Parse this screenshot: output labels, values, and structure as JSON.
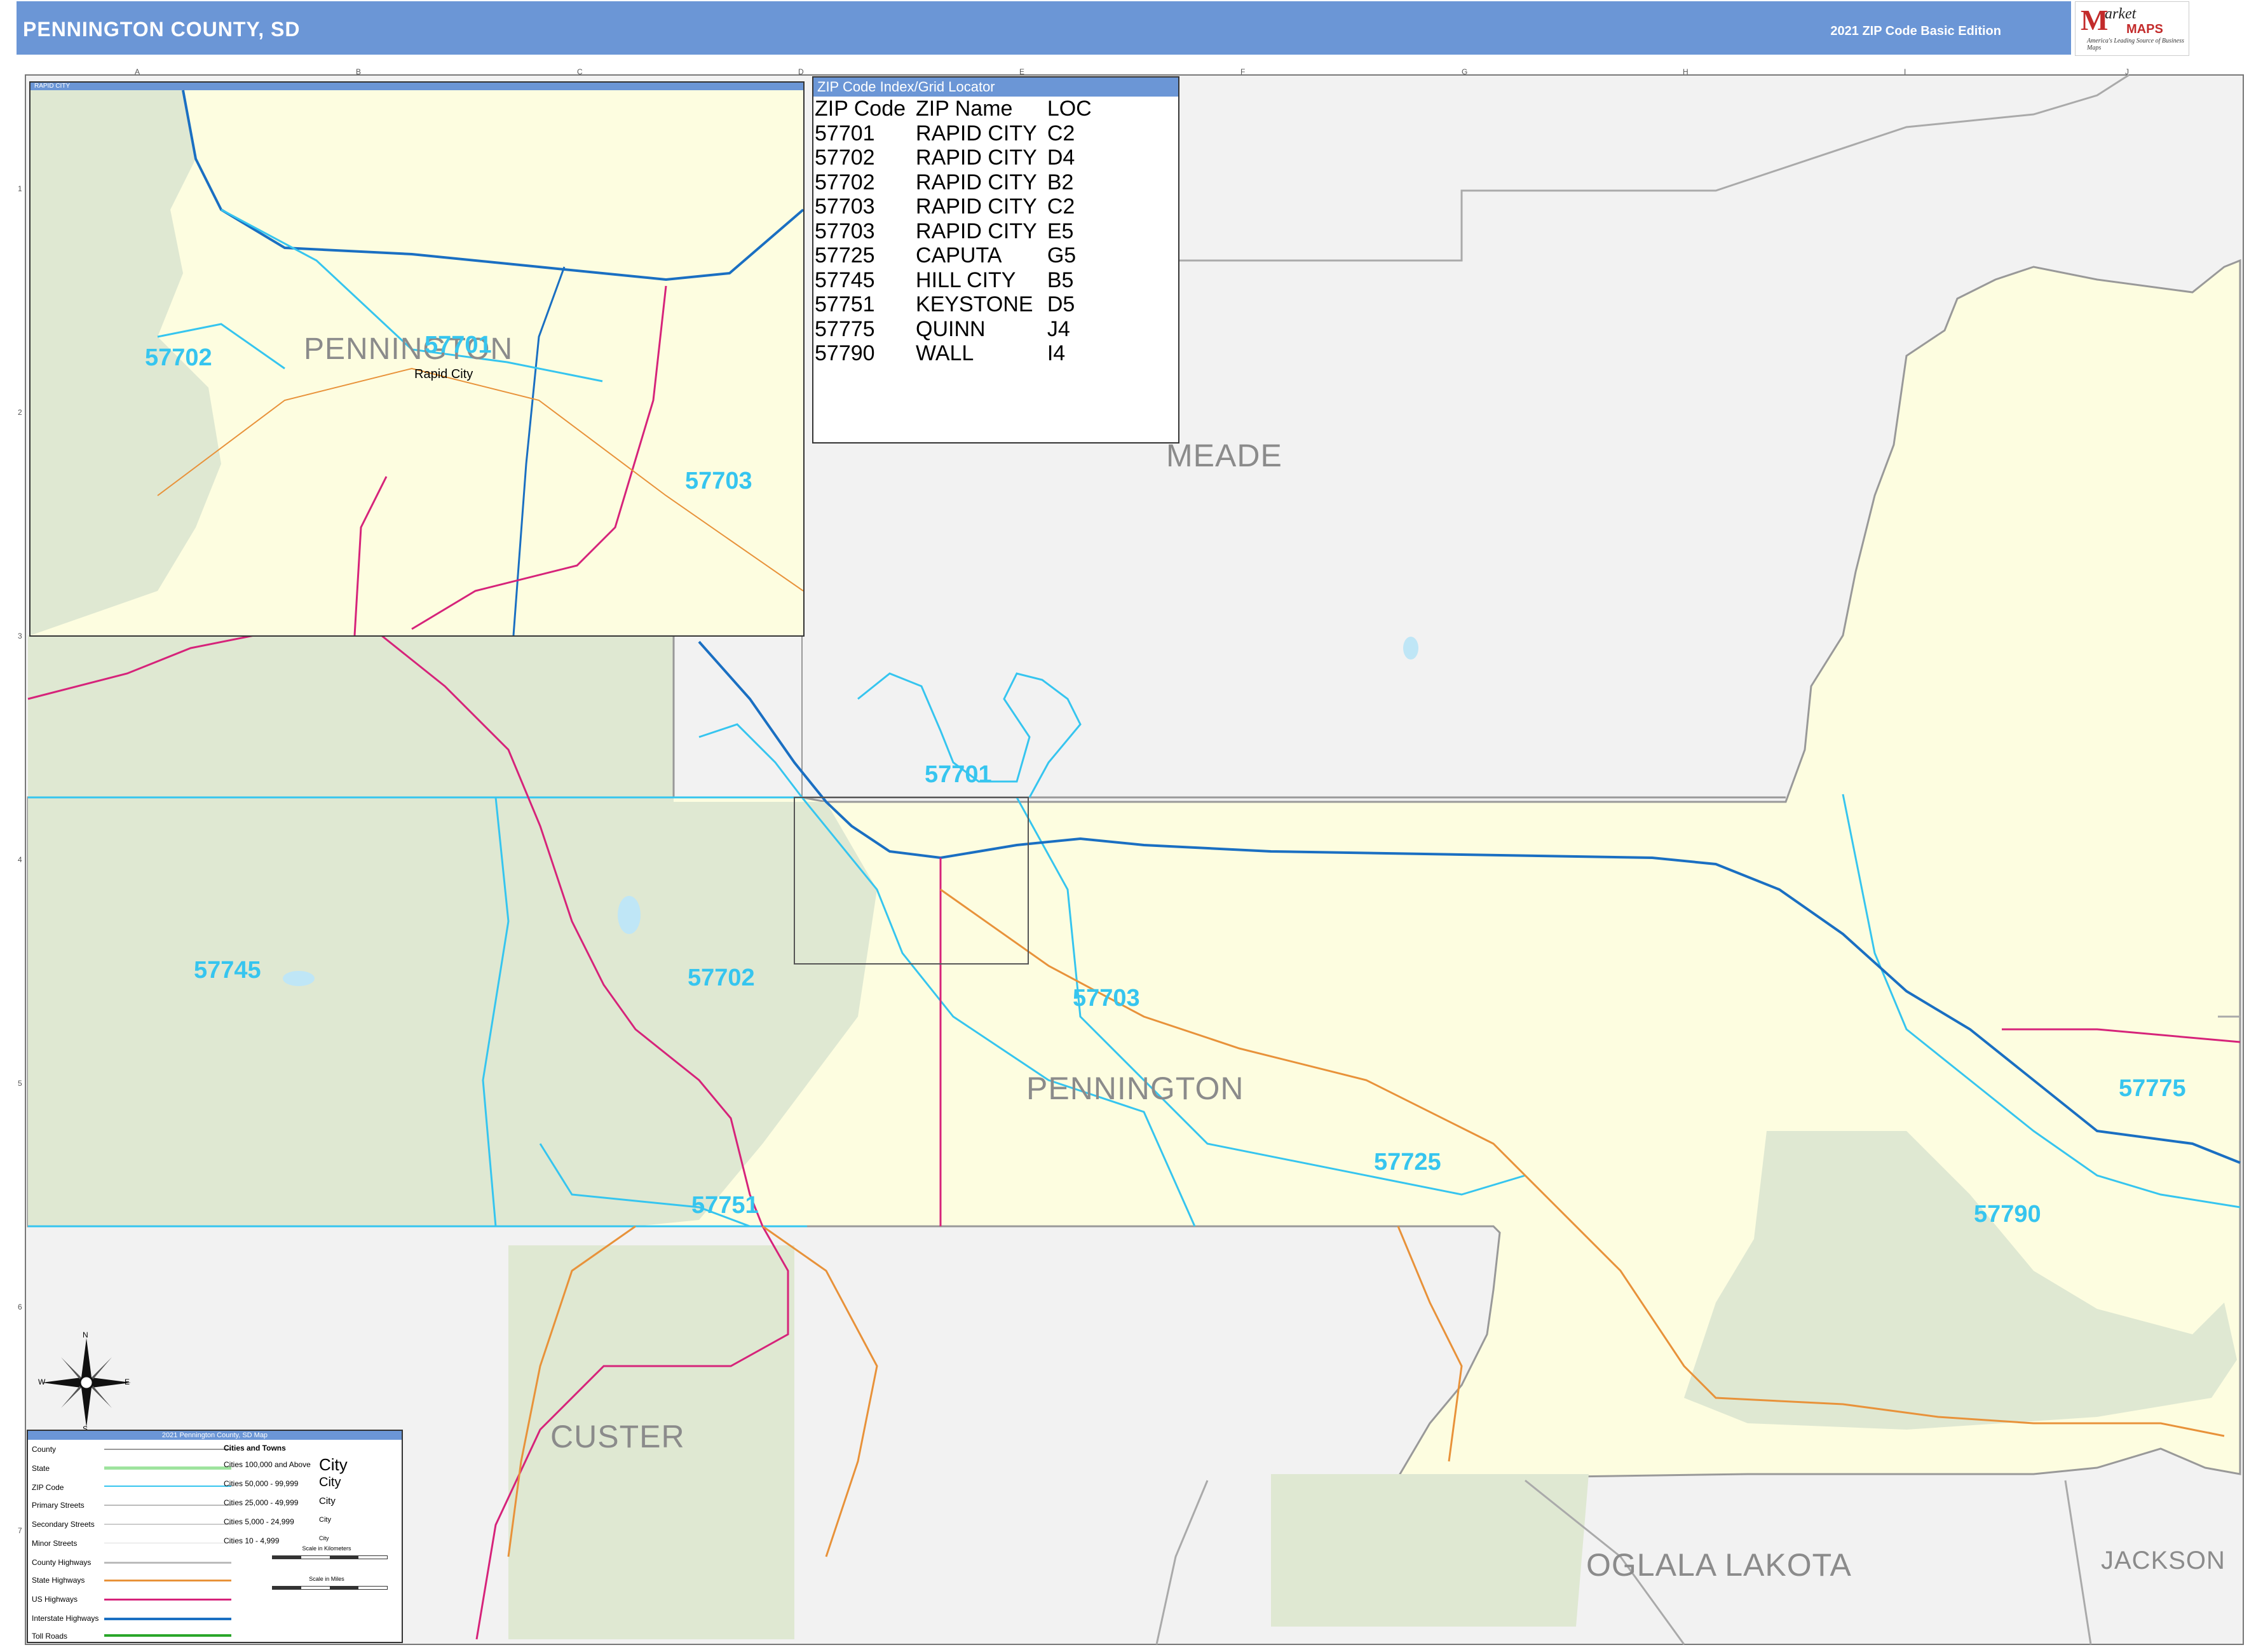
{
  "header": {
    "title": "PENNINGTON COUNTY, SD",
    "edition": "2021 ZIP Code Basic Edition"
  },
  "logo": {
    "m": "M",
    "market": "arket",
    "maps": "MAPS",
    "tagline": "America's Leading Source of Business Maps"
  },
  "grid": {
    "letters": [
      "A",
      "B",
      "C",
      "D",
      "E",
      "F",
      "G",
      "H",
      "I",
      "J"
    ],
    "numbers": [
      "1",
      "2",
      "3",
      "4",
      "5",
      "6",
      "7"
    ]
  },
  "inset": {
    "title": "RAPID CITY",
    "city_label": "Rapid City",
    "county_label": "PENNINGTON",
    "zips": [
      "57702",
      "57701",
      "57703"
    ]
  },
  "zip_index": {
    "title": "ZIP Code Index/Grid Locator",
    "headers": [
      "ZIP Code",
      "ZIP Name",
      "LOC"
    ],
    "rows": [
      [
        "57701",
        "RAPID CITY",
        "C2"
      ],
      [
        "57702",
        "RAPID CITY",
        "D4"
      ],
      [
        "57702",
        "RAPID CITY",
        "B2"
      ],
      [
        "57703",
        "RAPID CITY",
        "C2"
      ],
      [
        "57703",
        "RAPID CITY",
        "E5"
      ],
      [
        "57725",
        "CAPUTA",
        "G5"
      ],
      [
        "57745",
        "HILL CITY",
        "B5"
      ],
      [
        "57751",
        "KEYSTONE",
        "D5"
      ],
      [
        "57775",
        "QUINN",
        "J4"
      ],
      [
        "57790",
        "WALL",
        "I4"
      ]
    ]
  },
  "counties": {
    "meade": "MEADE",
    "pennington": "PENNINGTON",
    "custer": "CUSTER",
    "oglala": "OGLALA LAKOTA",
    "jackson": "JACKSON"
  },
  "zips": {
    "z57701": "57701",
    "z57745": "57745",
    "z57702": "57702",
    "z57703": "57703",
    "z57725": "57725",
    "z57751": "57751",
    "z57775": "57775",
    "z57790": "57790"
  },
  "legend": {
    "title": "2021 Pennington County, SD Map",
    "items": [
      "County",
      "State",
      "ZIP Code",
      "Primary Streets",
      "Secondary Streets",
      "Minor Streets",
      "County Highways",
      "State Highways",
      "US Highways",
      "Interstate Highways",
      "Toll Roads"
    ],
    "cities_header": "Cities and Towns",
    "city_sizes": [
      "Cities 100,000 and Above",
      "Cities 50,000 - 99,999",
      "Cities 25,000 - 49,999",
      "Cities 5,000 - 24,999",
      "Cities 10 - 4,999"
    ],
    "city_samples": [
      "City",
      "City",
      "City",
      "City",
      "City"
    ],
    "scale_km": "Scale in Kilometers",
    "scale_mi": "Scale in Miles"
  },
  "compass": {
    "n": "N",
    "s": "S",
    "e": "E",
    "w": "W"
  },
  "colors": {
    "header": "#6b96d6",
    "county_fill": "#fdfde0",
    "outside_fill": "#f2f2f2",
    "forest": "#dfe8d2",
    "zip_line": "#36c5ef",
    "interstate": "#1a6fc2",
    "us_highway": "#d6237a",
    "state_highway": "#e8923a"
  }
}
